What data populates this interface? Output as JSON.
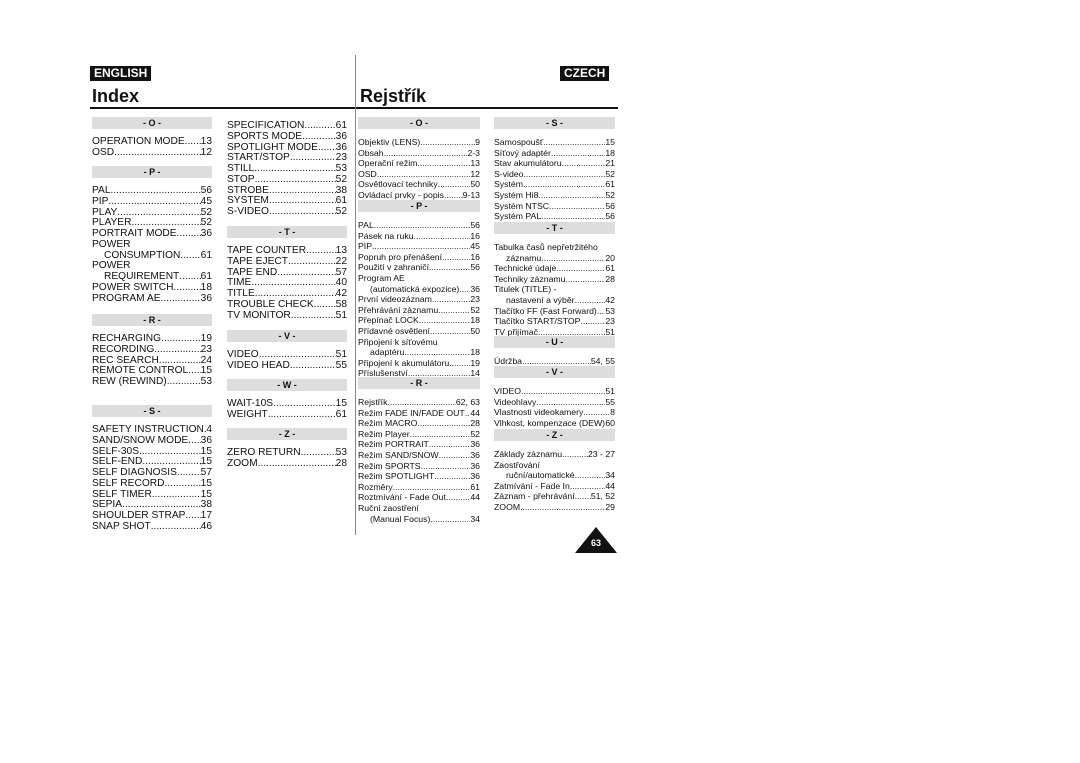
{
  "header": {
    "english": "ENGLISH",
    "czech": "CZECH",
    "index": "Index",
    "rejstrik": "Rejstřík"
  },
  "page_number": "63",
  "english": [
    {
      "col": 1,
      "h": "- O -",
      "items": [
        {
          "t": "OPERATION MODE",
          "p": "13"
        },
        {
          "t": "OSD",
          "p": "12"
        }
      ]
    },
    {
      "col": 1,
      "h": "- P -",
      "items": [
        {
          "t": "PAL",
          "p": "56"
        },
        {
          "t": "PIP",
          "p": "45"
        },
        {
          "t": "PLAY",
          "p": "52"
        },
        {
          "t": "PLAYER",
          "p": "52"
        },
        {
          "t": "PORTRAIT MODE",
          "p": "36"
        },
        {
          "t": "POWER",
          "p": ""
        },
        {
          "t": "CONSUMPTION",
          "p": "61",
          "i": 1
        },
        {
          "t": "POWER",
          "p": ""
        },
        {
          "t": "REQUIREMENT",
          "p": "61",
          "i": 1
        },
        {
          "t": "POWER SWITCH",
          "p": "18"
        },
        {
          "t": "PROGRAM AE",
          "p": "36"
        }
      ]
    },
    {
      "col": 1,
      "h": "- R -",
      "items": [
        {
          "t": "RECHARGING",
          "p": "19"
        },
        {
          "t": "RECORDING",
          "p": "23"
        },
        {
          "t": "REC SEARCH",
          "p": "24"
        },
        {
          "t": "REMOTE CONTROL",
          "p": "15"
        },
        {
          "t": "REW (REWIND)",
          "p": "53"
        }
      ]
    },
    {
      "col": 1,
      "h": "- S -",
      "items": [
        {
          "t": "SAFETY INSTRUCTION",
          "p": "4"
        },
        {
          "t": "SAND/SNOW MODE",
          "p": "36"
        },
        {
          "t": "SELF-30S",
          "p": "15"
        },
        {
          "t": "SELF-END",
          "p": "15"
        },
        {
          "t": "SELF DIAGNOSIS",
          "p": "57"
        },
        {
          "t": "SELF RECORD",
          "p": "15"
        },
        {
          "t": "SELF TIMER",
          "p": "15"
        },
        {
          "t": "SEPIA",
          "p": "38"
        },
        {
          "t": "SHOULDER STRAP",
          "p": "17"
        },
        {
          "t": "SNAP SHOT",
          "p": "46"
        }
      ]
    },
    {
      "col": 2,
      "h": "",
      "items": [
        {
          "t": "SPECIFICATION",
          "p": "61"
        },
        {
          "t": "SPORTS MODE",
          "p": "36"
        },
        {
          "t": "SPOTLIGHT MODE",
          "p": "36"
        },
        {
          "t": "START/STOP",
          "p": "23"
        },
        {
          "t": "STILL",
          "p": "53"
        },
        {
          "t": "STOP",
          "p": "52"
        },
        {
          "t": "STROBE",
          "p": "38"
        },
        {
          "t": "SYSTEM",
          "p": "61"
        },
        {
          "t": "S-VIDEO",
          "p": "52"
        }
      ]
    },
    {
      "col": 2,
      "h": "- T -",
      "items": [
        {
          "t": "TAPE COUNTER",
          "p": "13"
        },
        {
          "t": "TAPE EJECT",
          "p": "22"
        },
        {
          "t": "TAPE END",
          "p": "57"
        },
        {
          "t": "TIME",
          "p": "40"
        },
        {
          "t": "TITLE",
          "p": "42"
        },
        {
          "t": "TROUBLE CHECK",
          "p": "58"
        },
        {
          "t": "TV MONITOR",
          "p": "51"
        }
      ]
    },
    {
      "col": 2,
      "h": "- V -",
      "items": [
        {
          "t": "VIDEO",
          "p": "51"
        },
        {
          "t": "VIDEO HEAD",
          "p": "55"
        }
      ]
    },
    {
      "col": 2,
      "h": "- W -",
      "items": [
        {
          "t": "WAIT-10S",
          "p": "15"
        },
        {
          "t": "WEIGHT",
          "p": "61"
        }
      ]
    },
    {
      "col": 2,
      "h": "- Z -",
      "items": [
        {
          "t": "ZERO RETURN",
          "p": "53"
        },
        {
          "t": "ZOOM",
          "p": "28"
        }
      ]
    }
  ],
  "czech": [
    {
      "col": 3,
      "h": "- O -",
      "items": [
        {
          "t": "Objektiv (LENS)",
          "p": "9"
        },
        {
          "t": "Obsah",
          "p": "2-3"
        },
        {
          "t": "Operační režim",
          "p": "13"
        },
        {
          "t": "OSD",
          "p": "12"
        },
        {
          "t": "Osvětlovací techniky",
          "p": "50"
        },
        {
          "t": "Ovládací prvky - popis",
          "p": "9-13"
        }
      ]
    },
    {
      "col": 3,
      "h": "- P -",
      "items": [
        {
          "t": "PAL",
          "p": "56"
        },
        {
          "t": "Pásek na ruku",
          "p": "16"
        },
        {
          "t": "PIP",
          "p": "45"
        },
        {
          "t": "Popruh pro přenášení",
          "p": "16"
        },
        {
          "t": "Použití v zahraničí",
          "p": "56"
        },
        {
          "t": "Program AE",
          "p": ""
        },
        {
          "t": "(automatická expozice)",
          "p": "36",
          "i": 1
        },
        {
          "t": "První videozáznam",
          "p": "23"
        },
        {
          "t": "Přehrávání záznamu",
          "p": "52"
        },
        {
          "t": "Přepínač LOCK",
          "p": "18"
        },
        {
          "t": "Přídavné osvětlení",
          "p": "50"
        },
        {
          "t": "Připojení k síťovému",
          "p": ""
        },
        {
          "t": "adaptéru",
          "p": "18",
          "i": 1
        },
        {
          "t": "Připojení k akumulátoru",
          "p": "19"
        },
        {
          "t": "Příslušenství",
          "p": "14"
        }
      ]
    },
    {
      "col": 3,
      "h": "- R -",
      "items": [
        {
          "t": "Rejstřík",
          "p": "62, 63"
        },
        {
          "t": "Režim FADE IN/FADE OUT",
          "p": "44"
        },
        {
          "t": "Režim MACRO",
          "p": "28"
        },
        {
          "t": "Režim Player",
          "p": "52"
        },
        {
          "t": "Režim PORTRAIT",
          "p": "36"
        },
        {
          "t": "Režim SAND/SNOW",
          "p": "36"
        },
        {
          "t": "Režim SPORTS",
          "p": "36"
        },
        {
          "t": "Režim SPOTLIGHT",
          "p": "36"
        },
        {
          "t": "Rozměry",
          "p": "61"
        },
        {
          "t": "Roztmívání - Fade Out",
          "p": "44"
        },
        {
          "t": "Ruční zaostření",
          "p": ""
        },
        {
          "t": "(Manual Focus)",
          "p": "34",
          "i": 1
        }
      ]
    },
    {
      "col": 4,
      "h": "- S -",
      "items": [
        {
          "t": "Samospoušť",
          "p": "15"
        },
        {
          "t": "Síťový adaptér",
          "p": "18"
        },
        {
          "t": "Stav akumulátoru",
          "p": "21"
        },
        {
          "t": "S-video",
          "p": "52"
        },
        {
          "t": "Systém",
          "p": "61"
        },
        {
          "t": "Systém Hi8",
          "p": "52"
        },
        {
          "t": "Systém NTSC",
          "p": "56"
        },
        {
          "t": "Systém PAL",
          "p": "56"
        }
      ]
    },
    {
      "col": 4,
      "h": "- T -",
      "items": [
        {
          "t": "Tabulka časů nepřetržitého",
          "p": ""
        },
        {
          "t": "záznamu",
          "p": "20",
          "i": 1
        },
        {
          "t": "Technické údaje",
          "p": "61"
        },
        {
          "t": "Techniky záznamu",
          "p": "28"
        },
        {
          "t": "Titulek (TITLE) -",
          "p": ""
        },
        {
          "t": "nastavení a výběr",
          "p": "42",
          "i": 1
        },
        {
          "t": "Tlačítko FF (Fast Forward)",
          "p": "53"
        },
        {
          "t": "Tlačítko START/STOP",
          "p": "23"
        },
        {
          "t": "TV přijímač",
          "p": "51"
        }
      ]
    },
    {
      "col": 4,
      "h": "- U -",
      "items": [
        {
          "t": "Údržba",
          "p": "54, 55"
        }
      ]
    },
    {
      "col": 4,
      "h": "- V -",
      "items": [
        {
          "t": "VIDEO",
          "p": "51"
        },
        {
          "t": "Videohlavy",
          "p": "55"
        },
        {
          "t": "Vlastnosti videokamery",
          "p": "8"
        },
        {
          "t": "Vlhkost, kompenzace (DEW)",
          "p": "60"
        }
      ]
    },
    {
      "col": 4,
      "h": "- Z -",
      "items": [
        {
          "t": "Základy záznamu",
          "p": "23 - 27"
        },
        {
          "t": "Zaostřování",
          "p": ""
        },
        {
          "t": "ruční/automatické",
          "p": "34",
          "i": 1
        },
        {
          "t": "Zatmívání - Fade In",
          "p": "44"
        },
        {
          "t": "Záznam - přehrávání",
          "p": "51, 52"
        },
        {
          "t": "ZOOM",
          "p": "29"
        }
      ]
    }
  ]
}
